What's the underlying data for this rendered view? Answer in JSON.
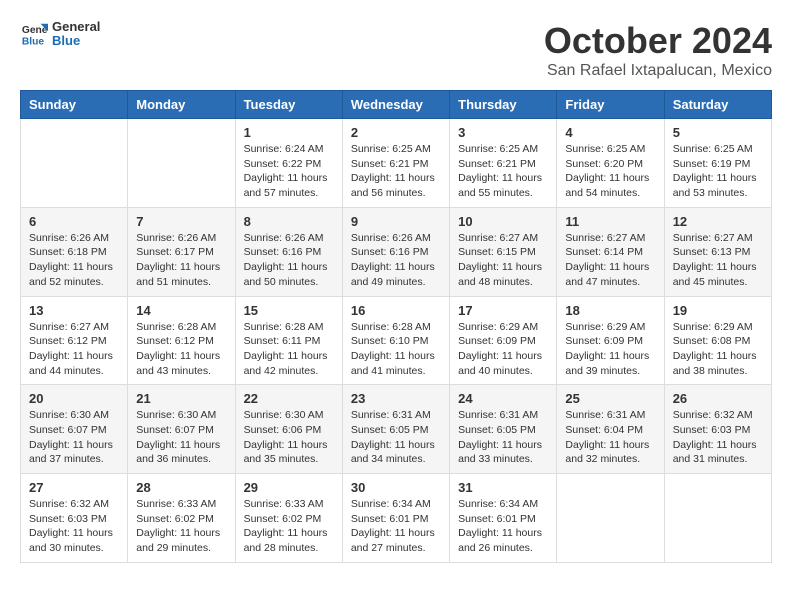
{
  "logo": {
    "general": "General",
    "blue": "Blue"
  },
  "title": "October 2024",
  "location": "San Rafael Ixtapalucan, Mexico",
  "weekdays": [
    "Sunday",
    "Monday",
    "Tuesday",
    "Wednesday",
    "Thursday",
    "Friday",
    "Saturday"
  ],
  "weeks": [
    [
      {
        "day": "",
        "detail": ""
      },
      {
        "day": "",
        "detail": ""
      },
      {
        "day": "1",
        "detail": "Sunrise: 6:24 AM\nSunset: 6:22 PM\nDaylight: 11 hours and 57 minutes."
      },
      {
        "day": "2",
        "detail": "Sunrise: 6:25 AM\nSunset: 6:21 PM\nDaylight: 11 hours and 56 minutes."
      },
      {
        "day": "3",
        "detail": "Sunrise: 6:25 AM\nSunset: 6:21 PM\nDaylight: 11 hours and 55 minutes."
      },
      {
        "day": "4",
        "detail": "Sunrise: 6:25 AM\nSunset: 6:20 PM\nDaylight: 11 hours and 54 minutes."
      },
      {
        "day": "5",
        "detail": "Sunrise: 6:25 AM\nSunset: 6:19 PM\nDaylight: 11 hours and 53 minutes."
      }
    ],
    [
      {
        "day": "6",
        "detail": "Sunrise: 6:26 AM\nSunset: 6:18 PM\nDaylight: 11 hours and 52 minutes."
      },
      {
        "day": "7",
        "detail": "Sunrise: 6:26 AM\nSunset: 6:17 PM\nDaylight: 11 hours and 51 minutes."
      },
      {
        "day": "8",
        "detail": "Sunrise: 6:26 AM\nSunset: 6:16 PM\nDaylight: 11 hours and 50 minutes."
      },
      {
        "day": "9",
        "detail": "Sunrise: 6:26 AM\nSunset: 6:16 PM\nDaylight: 11 hours and 49 minutes."
      },
      {
        "day": "10",
        "detail": "Sunrise: 6:27 AM\nSunset: 6:15 PM\nDaylight: 11 hours and 48 minutes."
      },
      {
        "day": "11",
        "detail": "Sunrise: 6:27 AM\nSunset: 6:14 PM\nDaylight: 11 hours and 47 minutes."
      },
      {
        "day": "12",
        "detail": "Sunrise: 6:27 AM\nSunset: 6:13 PM\nDaylight: 11 hours and 45 minutes."
      }
    ],
    [
      {
        "day": "13",
        "detail": "Sunrise: 6:27 AM\nSunset: 6:12 PM\nDaylight: 11 hours and 44 minutes."
      },
      {
        "day": "14",
        "detail": "Sunrise: 6:28 AM\nSunset: 6:12 PM\nDaylight: 11 hours and 43 minutes."
      },
      {
        "day": "15",
        "detail": "Sunrise: 6:28 AM\nSunset: 6:11 PM\nDaylight: 11 hours and 42 minutes."
      },
      {
        "day": "16",
        "detail": "Sunrise: 6:28 AM\nSunset: 6:10 PM\nDaylight: 11 hours and 41 minutes."
      },
      {
        "day": "17",
        "detail": "Sunrise: 6:29 AM\nSunset: 6:09 PM\nDaylight: 11 hours and 40 minutes."
      },
      {
        "day": "18",
        "detail": "Sunrise: 6:29 AM\nSunset: 6:09 PM\nDaylight: 11 hours and 39 minutes."
      },
      {
        "day": "19",
        "detail": "Sunrise: 6:29 AM\nSunset: 6:08 PM\nDaylight: 11 hours and 38 minutes."
      }
    ],
    [
      {
        "day": "20",
        "detail": "Sunrise: 6:30 AM\nSunset: 6:07 PM\nDaylight: 11 hours and 37 minutes."
      },
      {
        "day": "21",
        "detail": "Sunrise: 6:30 AM\nSunset: 6:07 PM\nDaylight: 11 hours and 36 minutes."
      },
      {
        "day": "22",
        "detail": "Sunrise: 6:30 AM\nSunset: 6:06 PM\nDaylight: 11 hours and 35 minutes."
      },
      {
        "day": "23",
        "detail": "Sunrise: 6:31 AM\nSunset: 6:05 PM\nDaylight: 11 hours and 34 minutes."
      },
      {
        "day": "24",
        "detail": "Sunrise: 6:31 AM\nSunset: 6:05 PM\nDaylight: 11 hours and 33 minutes."
      },
      {
        "day": "25",
        "detail": "Sunrise: 6:31 AM\nSunset: 6:04 PM\nDaylight: 11 hours and 32 minutes."
      },
      {
        "day": "26",
        "detail": "Sunrise: 6:32 AM\nSunset: 6:03 PM\nDaylight: 11 hours and 31 minutes."
      }
    ],
    [
      {
        "day": "27",
        "detail": "Sunrise: 6:32 AM\nSunset: 6:03 PM\nDaylight: 11 hours and 30 minutes."
      },
      {
        "day": "28",
        "detail": "Sunrise: 6:33 AM\nSunset: 6:02 PM\nDaylight: 11 hours and 29 minutes."
      },
      {
        "day": "29",
        "detail": "Sunrise: 6:33 AM\nSunset: 6:02 PM\nDaylight: 11 hours and 28 minutes."
      },
      {
        "day": "30",
        "detail": "Sunrise: 6:34 AM\nSunset: 6:01 PM\nDaylight: 11 hours and 27 minutes."
      },
      {
        "day": "31",
        "detail": "Sunrise: 6:34 AM\nSunset: 6:01 PM\nDaylight: 11 hours and 26 minutes."
      },
      {
        "day": "",
        "detail": ""
      },
      {
        "day": "",
        "detail": ""
      }
    ]
  ]
}
